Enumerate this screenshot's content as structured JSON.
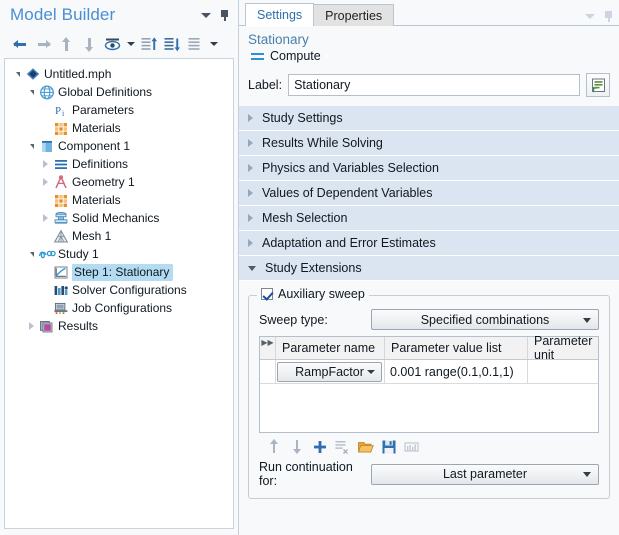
{
  "model_builder": {
    "title": "Model Builder",
    "corner_icons": [
      "chevron-down-icon",
      "pin-icon"
    ],
    "toolbar": [
      {
        "name": "back-button",
        "icon": "arrow-left-icon",
        "enabled": true
      },
      {
        "name": "forward-button",
        "icon": "arrow-right-icon",
        "enabled": false
      },
      {
        "name": "move-up-button",
        "icon": "arrow-up-icon",
        "enabled": false
      },
      {
        "name": "move-down-button",
        "icon": "arrow-down-icon",
        "enabled": false
      },
      {
        "name": "show-button",
        "icon": "eye-icon",
        "enabled": true
      },
      {
        "name": "show-dropdown",
        "icon": "chevron-down-icon",
        "enabled": true
      },
      {
        "name": "expand-all-button",
        "icon": "list-expand-icon",
        "enabled": true
      },
      {
        "name": "collapse-all-button",
        "icon": "list-collapse-icon",
        "enabled": true
      },
      {
        "name": "list-options-button",
        "icon": "list-icon",
        "enabled": true
      },
      {
        "name": "list-options-dropdown",
        "icon": "chevron-down-icon",
        "enabled": true
      }
    ],
    "tree": [
      {
        "label": "Untitled.mph",
        "depth": 0,
        "twist": "open",
        "icon": "comsol-file-icon",
        "selected": false
      },
      {
        "label": "Global Definitions",
        "depth": 1,
        "twist": "open",
        "icon": "globe-icon",
        "selected": false
      },
      {
        "label": "Parameters",
        "depth": 2,
        "twist": "none",
        "icon": "pi-icon",
        "selected": false
      },
      {
        "label": "Materials",
        "depth": 2,
        "twist": "none",
        "icon": "materials-icon",
        "selected": false
      },
      {
        "label": "Component 1",
        "depth": 1,
        "twist": "open",
        "icon": "component-icon",
        "selected": false
      },
      {
        "label": "Definitions",
        "depth": 2,
        "twist": "closed",
        "icon": "definitions-icon",
        "selected": false
      },
      {
        "label": "Geometry 1",
        "depth": 2,
        "twist": "closed",
        "icon": "geometry-icon",
        "selected": false
      },
      {
        "label": "Materials",
        "depth": 2,
        "twist": "none",
        "icon": "materials-icon",
        "selected": false
      },
      {
        "label": "Solid Mechanics",
        "depth": 2,
        "twist": "closed",
        "icon": "solid-mechanics-icon",
        "selected": false
      },
      {
        "label": "Mesh 1",
        "depth": 2,
        "twist": "none",
        "icon": "mesh-icon",
        "selected": false
      },
      {
        "label": "Study 1",
        "depth": 1,
        "twist": "open",
        "icon": "study-icon",
        "selected": false
      },
      {
        "label": "Step 1: Stationary",
        "depth": 2,
        "twist": "none",
        "icon": "stationary-icon",
        "selected": true
      },
      {
        "label": "Solver Configurations",
        "depth": 2,
        "twist": "none",
        "icon": "solver-icon",
        "selected": false
      },
      {
        "label": "Job Configurations",
        "depth": 2,
        "twist": "none",
        "icon": "job-icon",
        "selected": false
      },
      {
        "label": "Results",
        "depth": 1,
        "twist": "closed",
        "icon": "results-icon",
        "selected": false
      }
    ]
  },
  "settings": {
    "tabs": [
      {
        "label": "Settings",
        "active": true
      },
      {
        "label": "Properties",
        "active": false
      }
    ],
    "corner_icons": [
      "chevron-down-icon",
      "pin-icon"
    ],
    "node_title": "Stationary",
    "compute_label": "Compute",
    "label_caption": "Label:",
    "label_value": "Stationary",
    "description_button_icon": "description-icon",
    "sections": [
      {
        "label": "Study Settings",
        "expanded": false
      },
      {
        "label": "Results While Solving",
        "expanded": false
      },
      {
        "label": "Physics and Variables Selection",
        "expanded": false
      },
      {
        "label": "Values of Dependent Variables",
        "expanded": false
      },
      {
        "label": "Mesh Selection",
        "expanded": false
      },
      {
        "label": "Adaptation and Error Estimates",
        "expanded": false
      },
      {
        "label": "Study Extensions",
        "expanded": true
      }
    ],
    "study_extensions": {
      "auxiliary_sweep": {
        "label": "Auxiliary sweep",
        "checked": true
      },
      "sweep_type": {
        "caption": "Sweep type:",
        "value": "Specified combinations"
      },
      "table": {
        "columns": [
          "Parameter name",
          "Parameter value list",
          "Parameter unit"
        ],
        "rows": [
          {
            "parameter_name": "RampFactor",
            "parameter_value_list": "0.001 range(0.1,0.1,1)",
            "parameter_unit": ""
          }
        ]
      },
      "table_toolbar": [
        {
          "name": "move-up-button",
          "icon": "arrow-up-icon",
          "enabled": false
        },
        {
          "name": "move-down-button",
          "icon": "arrow-down-icon",
          "enabled": false
        },
        {
          "name": "add-button",
          "icon": "plus-icon",
          "enabled": true
        },
        {
          "name": "delete-button",
          "icon": "delete-list-icon",
          "enabled": false
        },
        {
          "name": "load-from-file-button",
          "icon": "open-folder-icon",
          "enabled": true
        },
        {
          "name": "save-to-file-button",
          "icon": "save-disk-icon",
          "enabled": true
        },
        {
          "name": "table-graph-button",
          "icon": "table-chart-icon",
          "enabled": false
        }
      ],
      "run_continuation": {
        "caption": "Run continuation for:",
        "value": "Last parameter"
      }
    }
  },
  "colors": {
    "accent_blue": "#2f6fad",
    "title_blue": "#4a8fd4",
    "section_header": "#dbe5f1",
    "selection": "#b3dcf2",
    "panel_bg": "#f7f9fb"
  }
}
